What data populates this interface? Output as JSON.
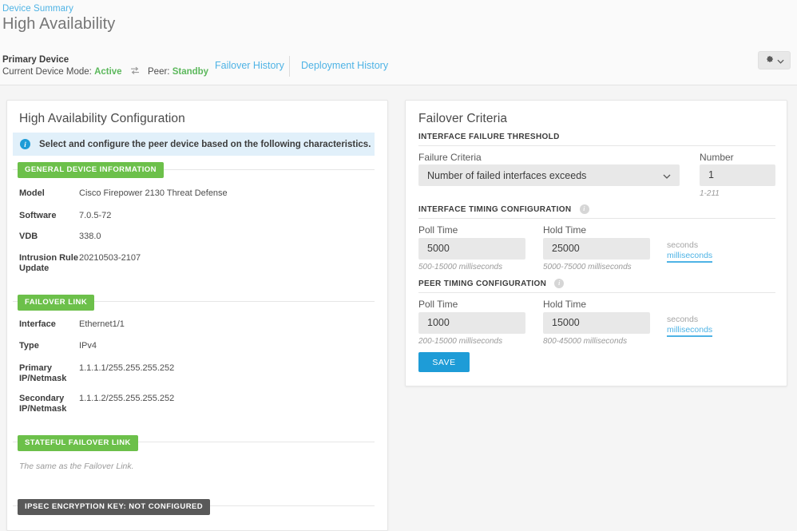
{
  "header": {
    "breadcrumb": "Device Summary",
    "page_title": "High Availability",
    "device_label": "Primary Device",
    "mode_label": "Current Device Mode:",
    "mode_value": "Active",
    "peer_label": "Peer:",
    "peer_value": "Standby",
    "swap_icon": "swap-arrows-icon",
    "gear_icon": "gear-icon",
    "caret_icon": "chevron-down-icon",
    "tabs": [
      {
        "label": "Failover History",
        "name": "failover-history"
      },
      {
        "label": "Deployment History",
        "name": "deployment-history"
      }
    ]
  },
  "left_panel": {
    "title": "High Availability Configuration",
    "banner": {
      "icon": "info-circle-icon",
      "text": "Select and configure the peer device based on the following characteristics."
    },
    "sections": [
      {
        "badge": "GENERAL DEVICE INFORMATION",
        "badge_style": "green",
        "rows": [
          {
            "key": "Model",
            "value": "Cisco Firepower 2130 Threat Defense"
          },
          {
            "key": "Software",
            "value": "7.0.5-72"
          },
          {
            "key": "VDB",
            "value": "338.0"
          },
          {
            "key": "Intrusion Rule Update",
            "value": "20210503-2107"
          }
        ]
      },
      {
        "badge": "FAILOVER LINK",
        "badge_style": "green",
        "rows": [
          {
            "key": "Interface",
            "value": "Ethernet1/1"
          },
          {
            "key": "Type",
            "value": "IPv4"
          },
          {
            "key": "Primary IP/Netmask",
            "value": "1.1.1.1/255.255.255.252"
          },
          {
            "key": "Secondary IP/Netmask",
            "value": "1.1.1.2/255.255.255.252"
          }
        ]
      },
      {
        "badge": "STATEFUL FAILOVER LINK",
        "badge_style": "green",
        "note": "The same as the Failover Link."
      },
      {
        "badge": "IPSEC ENCRYPTION KEY: NOT CONFIGURED",
        "badge_style": "dark"
      }
    ]
  },
  "right_panel": {
    "title": "Failover Criteria",
    "threshold": {
      "heading": "INTERFACE FAILURE THRESHOLD",
      "criteria_label": "Failure Criteria",
      "criteria_value": "Number of failed interfaces exceeds",
      "criteria_caret": "chevron-down-icon",
      "number_label": "Number",
      "number_value": "1",
      "number_hint": "1-211"
    },
    "interface_timing": {
      "heading": "INTERFACE TIMING CONFIGURATION",
      "info_icon": "info-circle-icon",
      "poll_label": "Poll Time",
      "poll_value": "5000",
      "poll_hint": "500-15000 milliseconds",
      "hold_label": "Hold Time",
      "hold_value": "25000",
      "hold_hint": "5000-75000 milliseconds",
      "unit_seconds": "seconds",
      "unit_milliseconds": "milliseconds"
    },
    "peer_timing": {
      "heading": "PEER TIMING CONFIGURATION",
      "info_icon": "info-circle-icon",
      "poll_label": "Poll Time",
      "poll_value": "1000",
      "poll_hint": "200-15000 milliseconds",
      "hold_label": "Hold Time",
      "hold_value": "15000",
      "hold_hint": "800-45000 milliseconds",
      "unit_seconds": "seconds",
      "unit_milliseconds": "milliseconds"
    },
    "save_label": "SAVE"
  },
  "colors": {
    "link_blue": "#4eb3e5",
    "accent_blue": "#1e9cd7",
    "status_green": "#5cb85c",
    "badge_green": "#6cc04a",
    "badge_dark": "#595959",
    "field_gray": "#e8e8e8"
  }
}
